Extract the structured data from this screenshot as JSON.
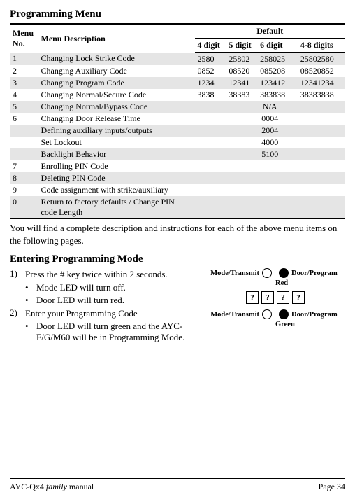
{
  "titles": {
    "programming_menu": "Programming Menu",
    "entering_mode": "Entering Programming Mode"
  },
  "table": {
    "headers": {
      "menu_no": "Menu No.",
      "menu_desc": "Menu Description",
      "default": "Default",
      "d4": "4 digit",
      "d5": "5 digit",
      "d6": "6 digit",
      "d48": "4-8 digits"
    },
    "rows": [
      {
        "alt": true,
        "no": "1",
        "desc": "Changing Lock Strike Code",
        "d4": "2580",
        "d5": "25802",
        "d6": "258025",
        "d48": "25802580",
        "na": false
      },
      {
        "alt": false,
        "no": "2",
        "desc": "Changing Auxiliary Code",
        "d4": "0852",
        "d5": "08520",
        "d6": "085208",
        "d48": "08520852",
        "na": false
      },
      {
        "alt": true,
        "no": "3",
        "desc": "Changing Program Code",
        "d4": "1234",
        "d5": "12341",
        "d6": "123412",
        "d48": "12341234",
        "na": false
      },
      {
        "alt": false,
        "no": "4",
        "desc": "Changing Normal/Secure Code",
        "d4": "3838",
        "d5": "38383",
        "d6": "383838",
        "d48": "38383838",
        "na": false
      },
      {
        "alt": true,
        "no": "5",
        "desc": "Changing Normal/Bypass Code",
        "na": true,
        "naText": "N/A"
      },
      {
        "alt": false,
        "no": "6",
        "desc": "Changing Door Release Time",
        "center": "0004"
      },
      {
        "alt": true,
        "no": "",
        "desc": "Defining auxiliary inputs/outputs",
        "center": "2004"
      },
      {
        "alt": false,
        "no": "",
        "desc": "Set Lockout",
        "center": "4000"
      },
      {
        "alt": true,
        "no": "",
        "desc": "Backlight Behavior",
        "center": "5100"
      },
      {
        "alt": false,
        "no": "7",
        "desc": "Enrolling PIN Code"
      },
      {
        "alt": true,
        "no": "8",
        "desc": "Deleting PIN Code"
      },
      {
        "alt": false,
        "no": "9",
        "desc": "Code assignment with strike/auxiliary"
      },
      {
        "alt": true,
        "no": "0",
        "desc": "Return to factory defaults / Change PIN code Length"
      }
    ]
  },
  "body_text": "You will find a complete description and instructions for each of the above menu items on the following pages.",
  "steps": {
    "step1_num": "1)",
    "step1_text": "Press the # key twice within 2 seconds.",
    "step1_b1": "Mode LED will turn off.",
    "step1_b2": "Door LED will turn red.",
    "step2_num": "2)",
    "step2_text": "Enter your Programming Code",
    "step2_b1": "Door LED will turn green and the AYC- F/G/M60 will be in Programming Mode."
  },
  "leds": {
    "mode": "Mode/Transmit",
    "door": "Door/Program",
    "red": "Red",
    "green": "Green"
  },
  "keypad": {
    "key": "?"
  },
  "bullet": "•",
  "footer": {
    "left_prefix": "AYC-Qx4",
    "left_suffix": " family",
    "left_word": " manual",
    "right": "Page 34"
  }
}
